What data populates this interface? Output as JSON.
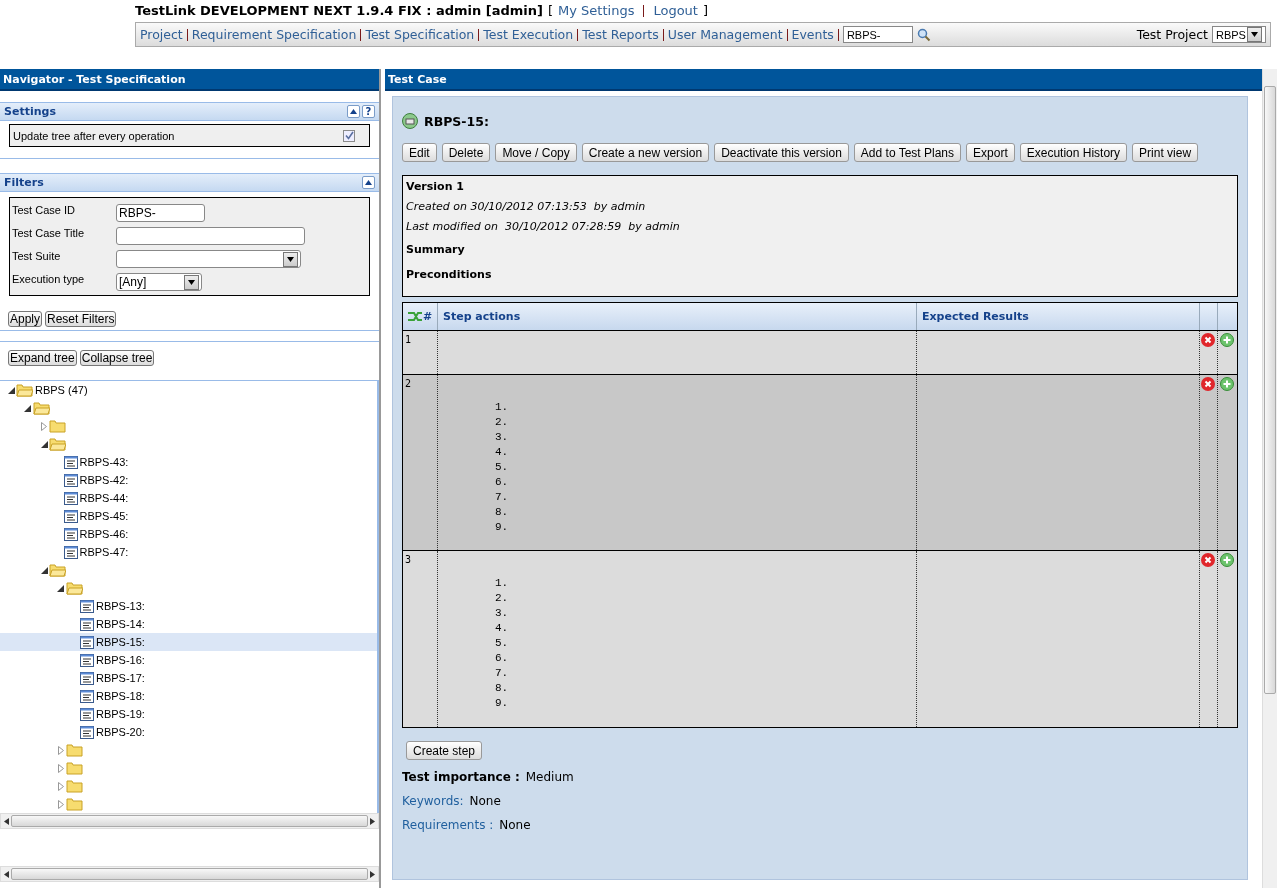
{
  "header": {
    "title": "TestLink DEVELOPMENT NEXT 1.9.4 FIX : admin [admin]",
    "bracket_open": "[",
    "links": [
      "My Settings",
      "Logout"
    ],
    "bracket_close": "]"
  },
  "menu": {
    "items": [
      "Project",
      "Requirement Specification",
      "Test Specification",
      "Test Execution",
      "Test Reports",
      "User Management",
      "Events"
    ],
    "search": {
      "value": "RBPS-"
    },
    "project_label": "Test Project",
    "project_select": {
      "value": "RBPS"
    }
  },
  "navigator": {
    "title": "Navigator - Test Specification",
    "settings": {
      "title": "Settings",
      "help": "?",
      "option": {
        "label": "Update tree after every operation",
        "checked": true
      }
    },
    "filters": {
      "title": "Filters",
      "fields": [
        {
          "label": "Test Case ID",
          "kind": "text",
          "value": "RBPS-"
        },
        {
          "label": "Test Case Title",
          "kind": "text"
        },
        {
          "label": "Test Suite",
          "kind": "select"
        },
        {
          "label": "Execution type",
          "kind": "select",
          "value": "[Any]"
        }
      ],
      "buttons": [
        "Apply",
        "Reset Filters"
      ]
    },
    "tree_buttons": [
      "Expand tree",
      "Collapse tree"
    ],
    "tree": [
      {
        "kind": "folder",
        "label": "RBPS (47)",
        "expanded": true,
        "selected": false,
        "children": [
          {
            "kind": "folder",
            "expanded": true,
            "selected": false,
            "children": [
              {
                "kind": "folder",
                "expanded": false,
                "selected": false
              },
              {
                "kind": "folder",
                "expanded": true,
                "selected": false,
                "children": [
                  {
                    "kind": "case",
                    "label": "RBPS-43:",
                    "selected": false
                  },
                  {
                    "kind": "case",
                    "label": "RBPS-42:",
                    "selected": false
                  },
                  {
                    "kind": "case",
                    "label": "RBPS-44:",
                    "selected": false
                  },
                  {
                    "kind": "case",
                    "label": "RBPS-45:",
                    "selected": false
                  },
                  {
                    "kind": "case",
                    "label": "RBPS-46:",
                    "selected": false
                  },
                  {
                    "kind": "case",
                    "label": "RBPS-47:",
                    "selected": false
                  }
                ]
              },
              {
                "kind": "folder",
                "expanded": true,
                "selected": false,
                "children": [
                  {
                    "kind": "folder",
                    "expanded": true,
                    "selected": false,
                    "children": [
                      {
                        "kind": "case",
                        "label": "RBPS-13:",
                        "selected": false
                      },
                      {
                        "kind": "case",
                        "label": "RBPS-14:",
                        "selected": false
                      },
                      {
                        "kind": "case",
                        "label": "RBPS-15:",
                        "selected": true
                      },
                      {
                        "kind": "case",
                        "label": "RBPS-16:",
                        "selected": false
                      },
                      {
                        "kind": "case",
                        "label": "RBPS-17:",
                        "selected": false
                      },
                      {
                        "kind": "case",
                        "label": "RBPS-18:",
                        "selected": false
                      },
                      {
                        "kind": "case",
                        "label": "RBPS-19:",
                        "selected": false
                      },
                      {
                        "kind": "case",
                        "label": "RBPS-20:",
                        "selected": false
                      }
                    ]
                  },
                  {
                    "kind": "folder",
                    "expanded": false,
                    "selected": false
                  },
                  {
                    "kind": "folder",
                    "expanded": false,
                    "selected": false
                  },
                  {
                    "kind": "folder",
                    "expanded": false,
                    "selected": false
                  },
                  {
                    "kind": "folder",
                    "expanded": false,
                    "selected": false
                  }
                ]
              }
            ]
          }
        ]
      }
    ]
  },
  "test_case": {
    "panel_title": "Test Case",
    "title": "RBPS-15:",
    "actions": [
      "Edit",
      "Delete",
      "Move / Copy",
      "Create a new version",
      "Deactivate this version",
      "Add to Test Plans",
      "Export",
      "Execution History",
      "Print view"
    ],
    "version": "Version 1",
    "created": "Created on 30/10/2012 07:13:53  by admin",
    "modified": "Last modified on  30/10/2012 07:28:59  by admin",
    "summary": "Summary",
    "preconditions": "Preconditions",
    "steps": {
      "columns": [
        "#",
        "Step actions",
        "Expected Results"
      ],
      "rows": [
        {
          "number": "1",
          "highlighted": false
        },
        {
          "number": "2",
          "highlighted": true,
          "actions": [
            "1.",
            "2.",
            "3.",
            "4.",
            "5.",
            "6.",
            "7.",
            "8.",
            "9."
          ]
        },
        {
          "number": "3",
          "highlighted": false,
          "actions": [
            "1.",
            "2.",
            "3.",
            "4.",
            "5.",
            "6.",
            "7.",
            "8.",
            "9."
          ]
        }
      ]
    },
    "create_step": "Create step",
    "importance": {
      "label": "Test importance :",
      "value": "Medium"
    },
    "keywords": {
      "label": "Keywords:",
      "value": "None"
    },
    "requirements": {
      "label": "Requirements :",
      "value": "None"
    }
  }
}
